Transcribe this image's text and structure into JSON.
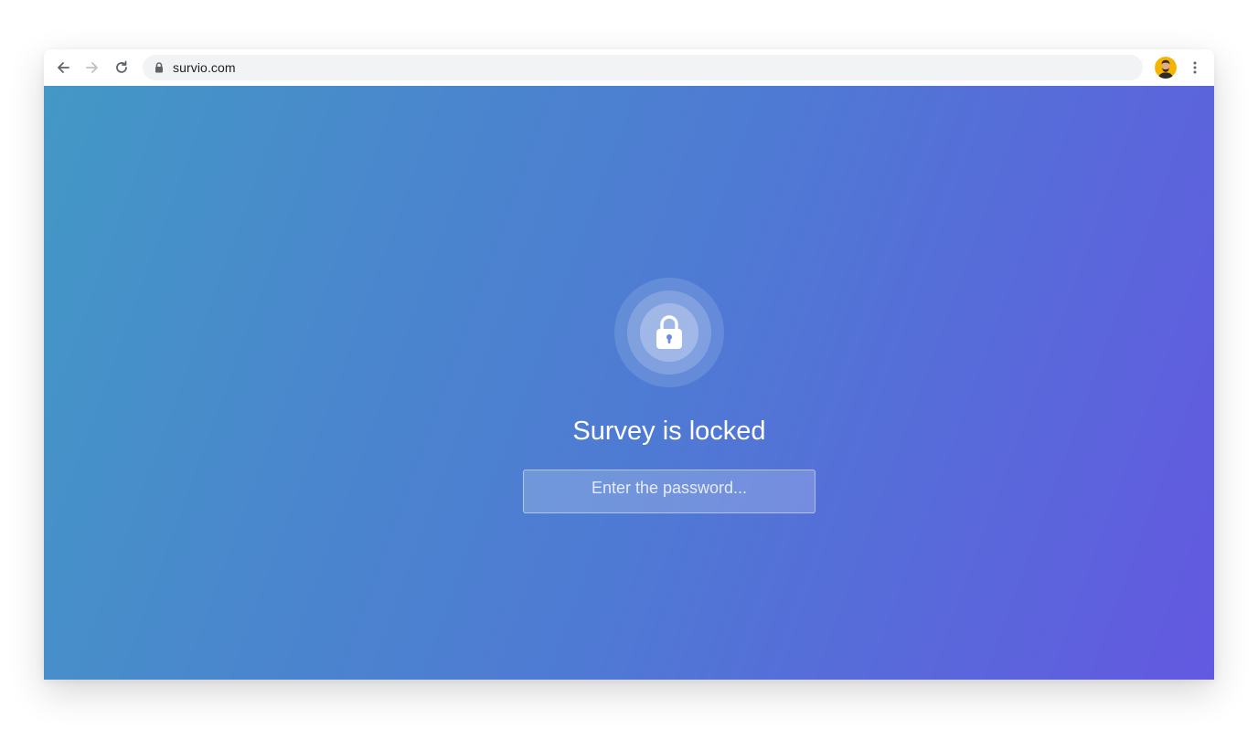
{
  "browser": {
    "url": "survio.com",
    "icons": {
      "back": "arrow-left-icon",
      "forward": "arrow-right-icon",
      "reload": "reload-icon",
      "secure": "lock-icon",
      "menu": "kebab-menu-icon"
    }
  },
  "page": {
    "title": "Survey is locked",
    "lock_icon": "padlock-icon",
    "password_placeholder": "Enter the password...",
    "password_value": ""
  },
  "colors": {
    "gradient_start": "#4398c6",
    "gradient_end": "#6359e0",
    "text": "#ffffff",
    "omnibox": "#f1f3f4"
  }
}
